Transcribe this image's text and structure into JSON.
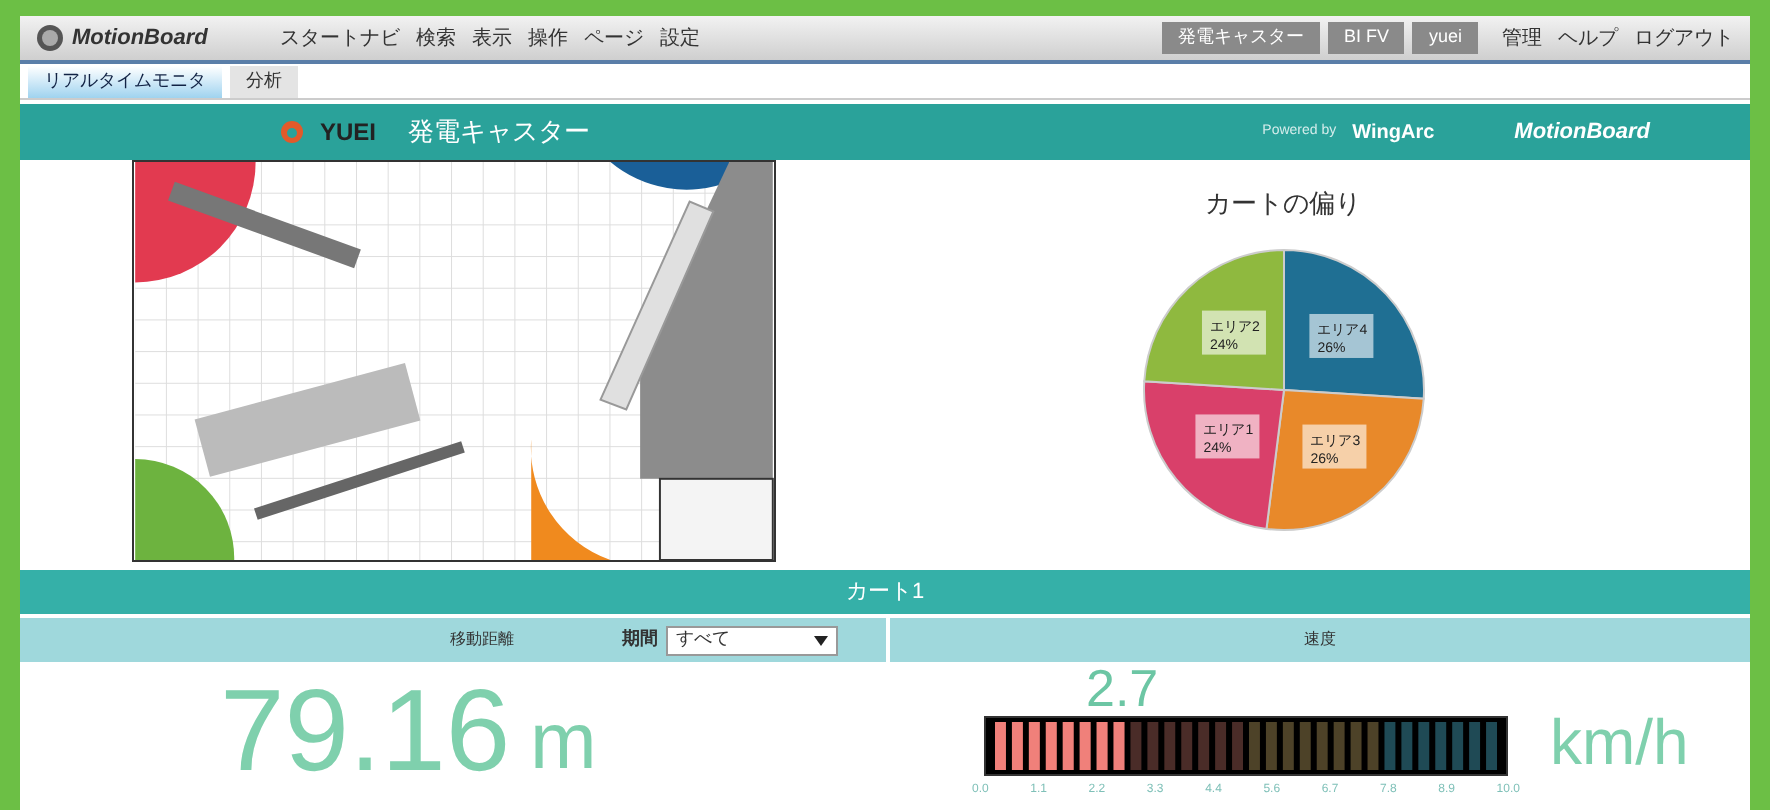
{
  "app": {
    "logo": "MotionBoard",
    "menu": [
      "スタートナビ",
      "検索",
      "表示",
      "操作",
      "ページ",
      "設定"
    ],
    "right_buttons": [
      "発電キャスター",
      "BI FV",
      "yuei"
    ],
    "right_menu": [
      "管理",
      "ヘルプ",
      "ログアウト"
    ]
  },
  "tabs": [
    {
      "label": "リアルタイムモニタ",
      "selected": true
    },
    {
      "label": "分析",
      "selected": false
    }
  ],
  "header": {
    "brand": "YUEI",
    "title": "発電キャスター",
    "powered_by": "Powered by",
    "vendor": "WingArc",
    "product": "MotionBoard"
  },
  "pie_panel": {
    "chart_data": {
      "type": "pie",
      "title": "カートの偏り",
      "categories": [
        "エリア4",
        "エリア3",
        "エリア1",
        "エリア2"
      ],
      "values": [
        26,
        26,
        24,
        24
      ],
      "colors": [
        "#1f6f93",
        "#e8892a",
        "#d9406a",
        "#8fb93f"
      ],
      "value_labels": [
        "26%",
        "26%",
        "24%",
        "24%"
      ]
    }
  },
  "cart": {
    "title": "カート1",
    "distance_label": "移動距離",
    "period_label": "期間",
    "period_value": "すべて",
    "speed_label": "速度",
    "distance": "79.16",
    "distance_unit": "m",
    "speed": "2.7",
    "speed_unit": "km/h",
    "level": 0.27,
    "scale": [
      "0.0",
      "1.1",
      "2.2",
      "3.3",
      "4.4",
      "5.6",
      "6.7",
      "7.8",
      "8.9",
      "10.0"
    ]
  }
}
